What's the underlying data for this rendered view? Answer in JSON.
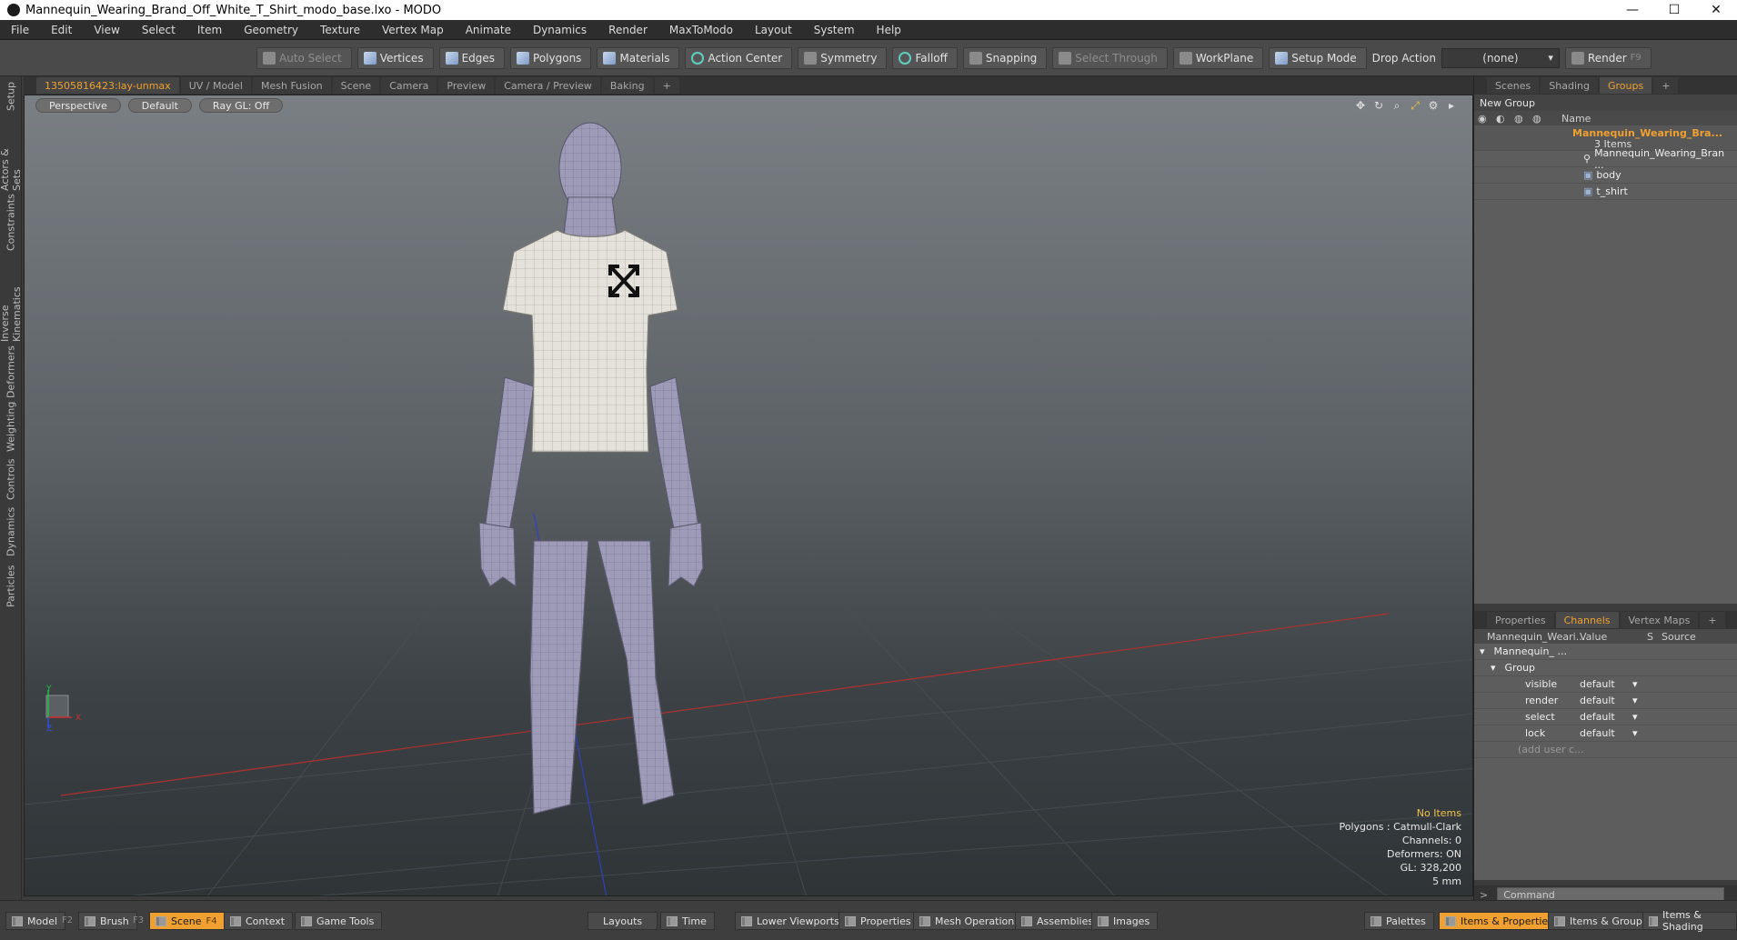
{
  "window": {
    "title": "Mannequin_Wearing_Brand_Off_White_T_Shirt_modo_base.lxo - MODO",
    "minimize": "—",
    "maximize": "☐",
    "close": "✕"
  },
  "menu": [
    "File",
    "Edit",
    "View",
    "Select",
    "Item",
    "Geometry",
    "Texture",
    "Vertex Map",
    "Animate",
    "Dynamics",
    "Render",
    "MaxToModo",
    "Layout",
    "System",
    "Help"
  ],
  "toolbar": {
    "auto_select": "Auto Select",
    "vertices": "Vertices",
    "edges": "Edges",
    "polygons": "Polygons",
    "materials": "Materials",
    "action_center": "Action Center",
    "symmetry": "Symmetry",
    "falloff": "Falloff",
    "snapping": "Snapping",
    "select_through": "Select Through",
    "workplane": "WorkPlane",
    "setup_mode": "Setup Mode",
    "drop_action": "Drop Action",
    "drop_value": "(none)",
    "render": "Render",
    "render_key": "F9"
  },
  "left_tabs": [
    "Setup",
    "Actors & Sets",
    "Constraints",
    "Inverse Kinematics",
    "Deformers",
    "Weighting",
    "Controls",
    "Dynamics",
    "Particles"
  ],
  "viewport_tabs": [
    "13505816423:lay-unmax",
    "UV / Model",
    "Mesh Fusion",
    "Scene",
    "Camera",
    "Preview",
    "Camera / Preview",
    "Baking",
    "+"
  ],
  "viewport": {
    "view": "Perspective",
    "shading": "Default",
    "raygl": "Ray GL: Off",
    "stats": {
      "items": "No Items",
      "polygons": "Polygons : Catmull-Clark",
      "channels": "Channels: 0",
      "deformers": "Deformers: ON",
      "gl": "GL: 328,200",
      "scale": "5 mm"
    },
    "axis_y": "Y",
    "axis_x": "X",
    "axis_z": "Z"
  },
  "right_top": {
    "tabs": [
      "Scenes",
      "Shading",
      "Groups",
      "+"
    ],
    "active": "Groups",
    "new_group": "New Group",
    "name_col": "Name",
    "root": "Mannequin_Wearing_Bra...",
    "root_count": "3 Items",
    "children": [
      "Mannequin_Wearing_Bran ...",
      "body",
      "t_shirt"
    ]
  },
  "right_bottom": {
    "tabs": [
      "Properties",
      "Channels",
      "Vertex Maps",
      "+"
    ],
    "active": "Channels",
    "cols": {
      "name": "Mannequin_Weari...",
      "value": "Value",
      "s": "S",
      "source": "Source"
    },
    "root": "Mannequin_ ...",
    "group": "Group",
    "channels": [
      {
        "name": "visible",
        "value": "default"
      },
      {
        "name": "render",
        "value": "default"
      },
      {
        "name": "select",
        "value": "default"
      },
      {
        "name": "lock",
        "value": "default"
      }
    ],
    "add_user": "(add user c...",
    "command_prompt": ">",
    "command_placeholder": "Command"
  },
  "bottom": {
    "model": "Model",
    "model_key": "F2",
    "brush": "Brush",
    "brush_key": "F3",
    "scene": "Scene",
    "scene_key": "F4",
    "context": "Context",
    "game_tools": "Game Tools",
    "layouts": "Layouts",
    "time": "Time",
    "lower_viewports": "Lower Viewports",
    "properties": "Properties",
    "mesh_operations": "Mesh Operations",
    "assemblies": "Assemblies",
    "images": "Images",
    "palettes": "Palettes",
    "items_properties": "Items & Properties",
    "items_groups": "Items & Groups",
    "items_shading": "Items & Shading"
  },
  "colors": {
    "accent": "#f0a030",
    "stats_highlight": "#f3c14b"
  }
}
